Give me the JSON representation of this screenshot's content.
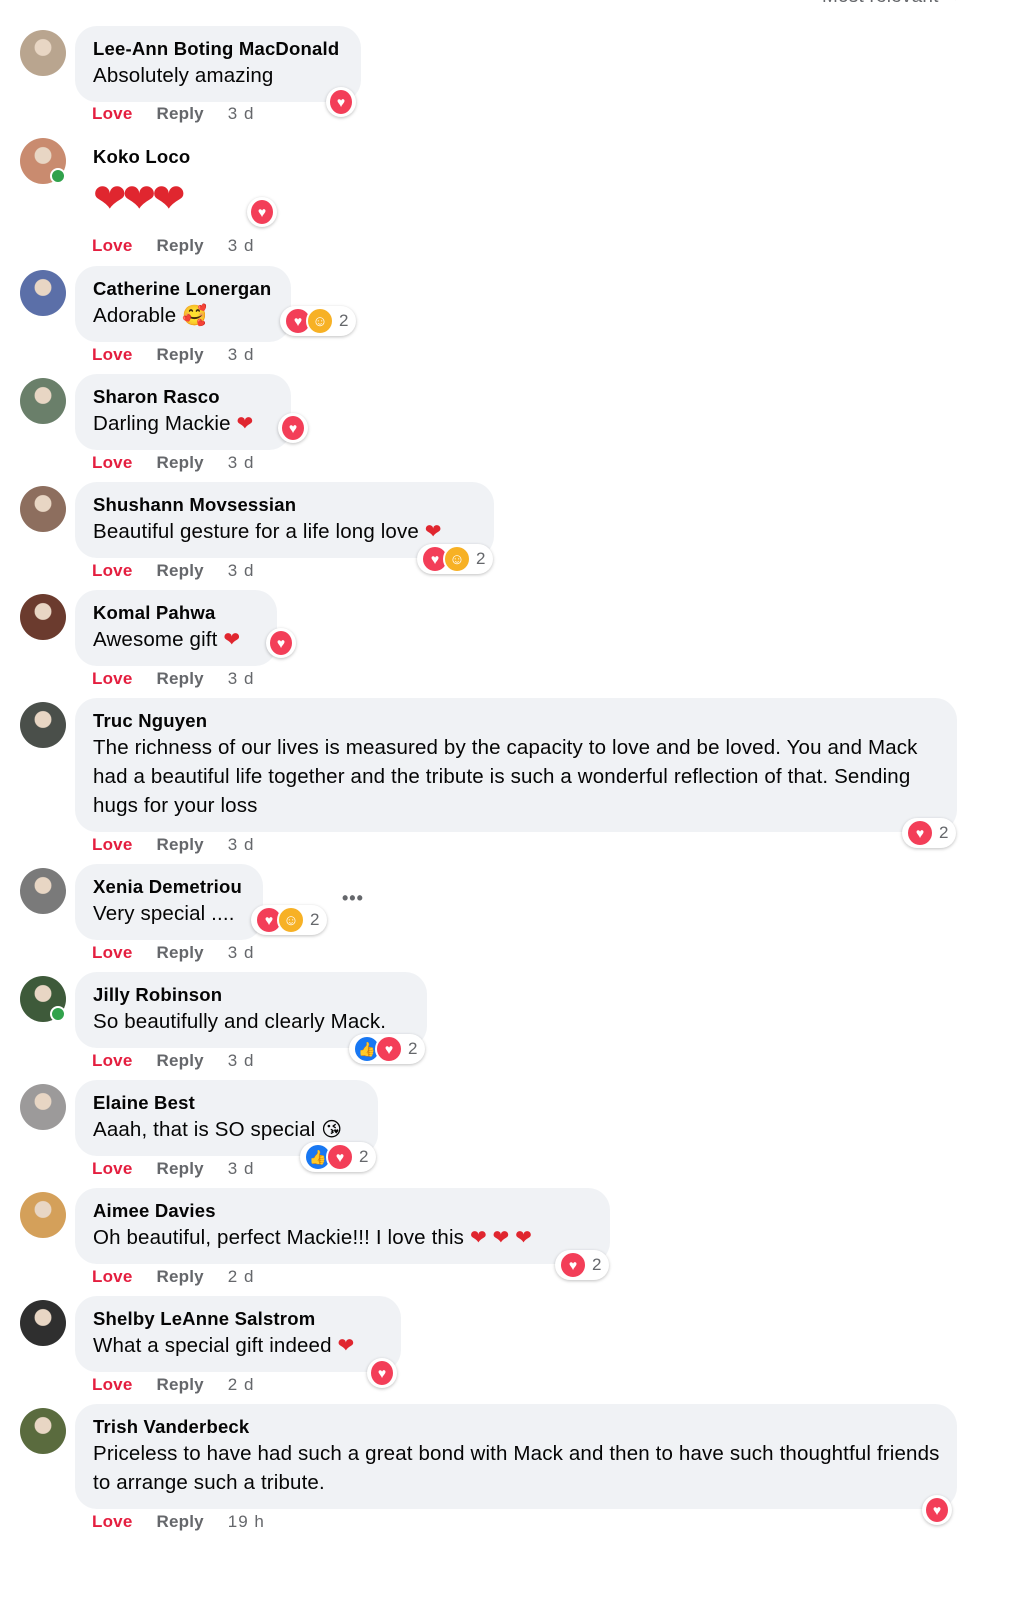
{
  "sort_label": "Most relevant",
  "love_label": "Love",
  "reply_label": "Reply",
  "comments": [
    {
      "name": "Lee-Ann Boting MacDonald",
      "text": "Absolutely amazing",
      "time": "3 d",
      "reactions": [
        "love"
      ],
      "count": ""
    },
    {
      "name": "Koko Loco",
      "text": "",
      "big_emoji": "❤❤❤",
      "time": "3 d",
      "reactions": [
        "love"
      ],
      "count": "",
      "online": true
    },
    {
      "name": "Catherine Lonergan",
      "text": "Adorable",
      "emoji": "🥰",
      "time": "3 d",
      "reactions": [
        "love",
        "care"
      ],
      "count": "2"
    },
    {
      "name": "Sharon Rasco",
      "text": "Darling Mackie",
      "emoji": "❤",
      "time": "3 d",
      "reactions": [
        "love"
      ],
      "count": ""
    },
    {
      "name": "Shushann Movsessian",
      "text": "Beautiful gesture for a life long love",
      "emoji": "❤",
      "time": "3 d",
      "reactions": [
        "love",
        "care"
      ],
      "count": "2"
    },
    {
      "name": "Komal Pahwa",
      "text": "Awesome gift",
      "emoji": "❤",
      "time": "3 d",
      "reactions": [
        "love"
      ],
      "count": ""
    },
    {
      "name": "Truc Nguyen",
      "text": "The richness of our lives is measured by the capacity to love and be loved. You and Mack had a beautiful life together and the tribute is such a wonderful reflection of that. Sending hugs for your loss",
      "time": "3 d",
      "reactions": [
        "love"
      ],
      "count": "2"
    },
    {
      "name": "Xenia Demetriou",
      "text": "Very special ....",
      "time": "3 d",
      "reactions": [
        "love",
        "care"
      ],
      "count": "2"
    },
    {
      "name": "Jilly Robinson",
      "text": "So beautifully and clearly Mack.",
      "time": "3 d",
      "reactions": [
        "like",
        "love"
      ],
      "count": "2",
      "online": true
    },
    {
      "name": "Elaine Best",
      "text": "Aaah, that is SO special",
      "emoji": "😘",
      "time": "3 d",
      "reactions": [
        "like",
        "love"
      ],
      "count": "2"
    },
    {
      "name": "Aimee Davies",
      "text": "Oh beautiful, perfect Mackie!!! I love this",
      "emoji": "❤ ❤ ❤",
      "time": "2 d",
      "reactions": [
        "love"
      ],
      "count": "2"
    },
    {
      "name": "Shelby LeAnne Salstrom",
      "text": "What a special gift indeed",
      "emoji": "❤",
      "time": "2 d",
      "reactions": [
        "love"
      ],
      "count": ""
    },
    {
      "name": "Trish Vanderbeck",
      "text": "Priceless to have had such a great bond with Mack and then to have such thoughtful friends to arrange such a tribute.",
      "time": "19 h",
      "reactions": [
        "love"
      ],
      "count": ""
    }
  ],
  "avatar_colors": [
    "#b9a58f",
    "#c98b6f",
    "#5b6fa8",
    "#6a7f6a",
    "#8d6e5e",
    "#6b3b2e",
    "#4a4f4a",
    "#7a7a7a",
    "#3e5a3a",
    "#9c9a9a",
    "#d4a05a",
    "#2f2f2f",
    "#5a6b3e"
  ]
}
